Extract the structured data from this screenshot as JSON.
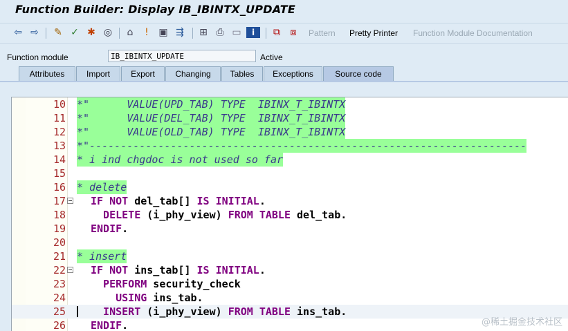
{
  "window": {
    "title": "Function Builder: Display IB_IBINTX_UPDATE"
  },
  "toolbar": {
    "icons": [
      "back-arrow-icon",
      "forward-arrow-icon",
      "edit-pencil-icon",
      "check-syntax-icon",
      "activate-icon",
      "where-used-icon",
      "test-icon",
      "info-icon",
      "display-object-list-icon",
      "navigate-icon",
      "hierarchy-icon",
      "print-icon",
      "window-icon",
      "info-i-icon",
      "pattern-icon-a",
      "pattern-icon-b"
    ],
    "pattern_label": "Pattern",
    "pretty_printer_label": "Pretty Printer",
    "fm_doc_label": "Function Module Documentation"
  },
  "header": {
    "fm_label": "Function module",
    "fm_value": "IB_IBINTX_UPDATE",
    "status": "Active"
  },
  "tabs": [
    {
      "label": "Attributes"
    },
    {
      "label": "Import"
    },
    {
      "label": "Export"
    },
    {
      "label": "Changing"
    },
    {
      "label": "Tables"
    },
    {
      "label": "Exceptions"
    },
    {
      "label": "Source code"
    }
  ],
  "editor": {
    "lines": [
      {
        "num": "10",
        "text": "*\"      VALUE(UPD_TAB) TYPE  IBINX_T_IBINTX"
      },
      {
        "num": "11",
        "text": "*\"      VALUE(DEL_TAB) TYPE  IBINX_T_IBINTX"
      },
      {
        "num": "12",
        "text": "*\"      VALUE(OLD_TAB) TYPE  IBINX_T_IBINTX"
      },
      {
        "num": "13",
        "text": "*\"----------------------------------------------------------------------"
      },
      {
        "num": "14",
        "text": "* i ind chgdoc is not used so far"
      },
      {
        "num": "15",
        "text": ""
      },
      {
        "num": "16",
        "text": "* delete"
      },
      {
        "num": "17",
        "kw1": "IF NOT",
        "id1": " del_tab[] ",
        "kw2": "IS INITIAL",
        "tail": "."
      },
      {
        "num": "18",
        "kw1": "  DELETE",
        "id1": " (i_phy_view) ",
        "kw2": "FROM TABLE",
        "tail": " del_tab."
      },
      {
        "num": "19",
        "kw1": "ENDIF",
        "tail": "."
      },
      {
        "num": "20",
        "text": ""
      },
      {
        "num": "21",
        "text": "* insert"
      },
      {
        "num": "22",
        "kw1": "IF NOT",
        "id1": " ins_tab[] ",
        "kw2": "IS INITIAL",
        "tail": "."
      },
      {
        "num": "23",
        "kw1": "  PERFORM",
        "tail": " security_check"
      },
      {
        "num": "24",
        "kw1": "    USING",
        "tail": " ins_tab."
      },
      {
        "num": "25",
        "kw1": "  INSERT",
        "id1": " (i_phy_view) ",
        "kw2": "FROM TABLE",
        "tail": " ins_tab."
      },
      {
        "num": "26",
        "kw1": "ENDIF",
        "tail": "."
      }
    ]
  },
  "watermark": "@稀土掘金技术社区"
}
